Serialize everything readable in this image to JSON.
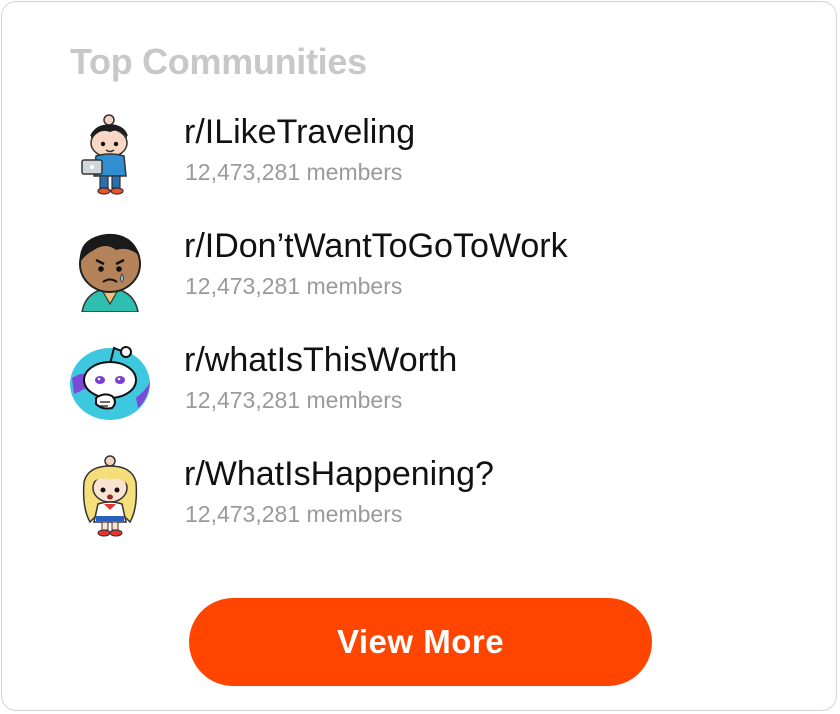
{
  "widget": {
    "title": "Top Communities",
    "view_more_label": "View More"
  },
  "communities": [
    {
      "name": "r/ILikeTraveling",
      "members": "12,473,281 members",
      "avatar": "traveler-avatar-icon"
    },
    {
      "name": "r/IDon’tWantToGoToWork",
      "members": "12,473,281 members",
      "avatar": "sad-worker-avatar-icon"
    },
    {
      "name": "r/whatIsThisWorth",
      "members": "12,473,281 members",
      "avatar": "thinking-snoo-avatar-icon"
    },
    {
      "name": "r/WhatIsHappening?",
      "members": "12,473,281 members",
      "avatar": "blonde-girl-avatar-icon"
    }
  ],
  "colors": {
    "accent": "#ff4500",
    "title": "#c8c8c8",
    "muted": "#9a9a9a"
  }
}
